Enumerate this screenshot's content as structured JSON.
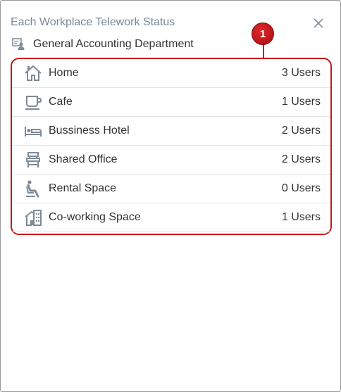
{
  "dialog": {
    "title": "Each Workplace Telework Status",
    "department": "General Accounting Department"
  },
  "rows": [
    {
      "icon": "home-icon",
      "label": "Home",
      "count": "3 Users"
    },
    {
      "icon": "cafe-icon",
      "label": "Cafe",
      "count": "1 Users"
    },
    {
      "icon": "hotel-bed-icon",
      "label": "Bussiness Hotel",
      "count": "2 Users"
    },
    {
      "icon": "shared-office-icon",
      "label": "Shared Office",
      "count": "2 Users"
    },
    {
      "icon": "rental-seat-icon",
      "label": "Rental Space",
      "count": "0 Users"
    },
    {
      "icon": "coworking-building-icon",
      "label": "Co-working Space",
      "count": "1 Users"
    }
  ],
  "annotation": {
    "number": "1",
    "color": "#c4161c"
  },
  "colors": {
    "icon": "#7d8a97",
    "title": "#7a8896",
    "text": "#333333",
    "border": "#c4161c"
  }
}
